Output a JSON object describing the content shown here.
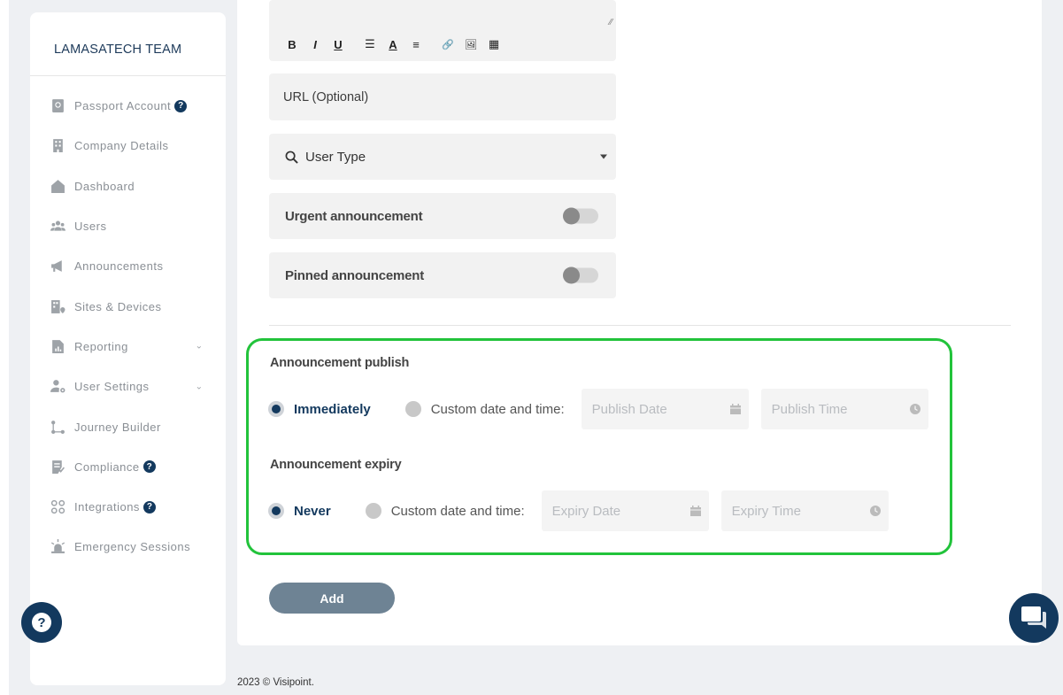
{
  "sidebar": {
    "team_name": "LAMASATECH TEAM",
    "items": [
      {
        "label": "Passport Account",
        "icon": "passport-icon",
        "help": true
      },
      {
        "label": "Company Details",
        "icon": "building-icon"
      },
      {
        "label": "Dashboard",
        "icon": "home-icon"
      },
      {
        "label": "Users",
        "icon": "users-icon"
      },
      {
        "label": "Announcements",
        "icon": "megaphone-icon"
      },
      {
        "label": "Sites & Devices",
        "icon": "site-devices-icon"
      },
      {
        "label": "Reporting",
        "icon": "report-icon",
        "chevron": true
      },
      {
        "label": "User Settings",
        "icon": "user-settings-icon",
        "chevron": true
      },
      {
        "label": "Journey Builder",
        "icon": "journey-icon"
      },
      {
        "label": "Compliance",
        "icon": "compliance-icon",
        "help": true
      },
      {
        "label": "Integrations",
        "icon": "integrations-icon",
        "help": true
      },
      {
        "label": "Emergency Sessions",
        "icon": "alarm-icon"
      }
    ],
    "help_glyph": "?",
    "help_fab_glyph": "?"
  },
  "editor": {
    "toolbar": [
      "B",
      "I",
      "U",
      "☰",
      "A",
      "≡",
      "🔗",
      "🖼",
      "▦"
    ],
    "resize_glyph": "⁄⁄"
  },
  "form": {
    "url_placeholder": "URL (Optional)",
    "user_type_label": "User Type",
    "urgent_label": "Urgent announcement",
    "urgent_on": false,
    "pinned_label": "Pinned announcement",
    "pinned_on": false
  },
  "publish": {
    "title": "Announcement publish",
    "option_immediate": "Immediately",
    "option_custom": "Custom date and time:",
    "selected": "immediate",
    "date_placeholder": "Publish Date",
    "time_placeholder": "Publish Time"
  },
  "expiry": {
    "title": "Announcement expiry",
    "option_never": "Never",
    "option_custom": "Custom date and time:",
    "selected": "never",
    "date_placeholder": "Expiry Date",
    "time_placeholder": "Expiry Time"
  },
  "actions": {
    "add_label": "Add"
  },
  "footer": {
    "text": "2023 © Visipoint."
  },
  "colors": {
    "brand_navy": "#13395e",
    "highlight_green": "#22c33b",
    "button_slate": "#6e8394"
  }
}
